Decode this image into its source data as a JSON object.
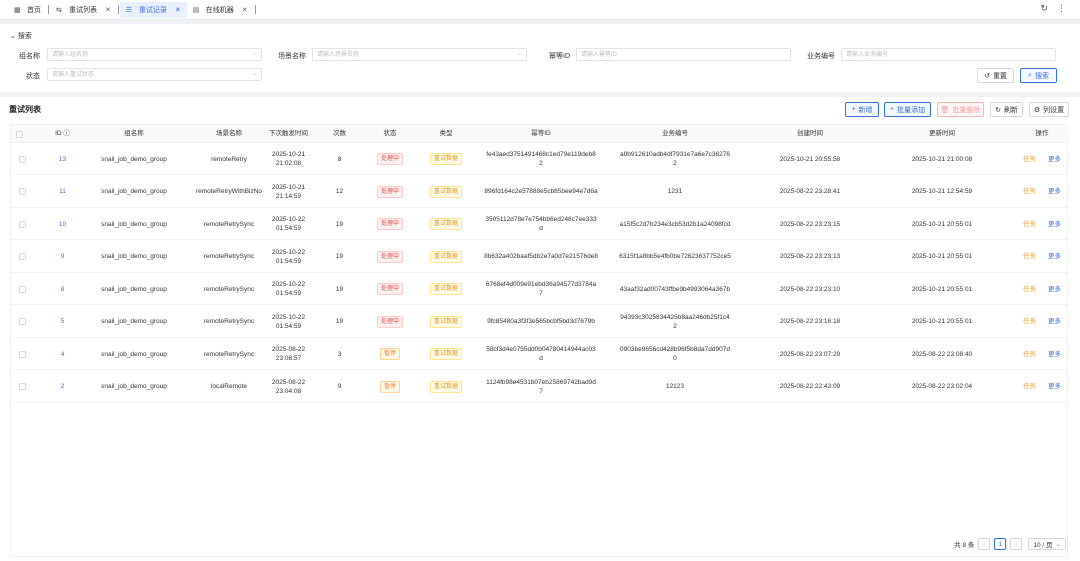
{
  "tabs": [
    {
      "icon": "grid-icon",
      "label": "首页"
    },
    {
      "icon": "flow-icon",
      "label": "重试列表"
    },
    {
      "icon": "list-icon",
      "label": "重试记录"
    },
    {
      "icon": "server-icon",
      "label": "在线机器"
    }
  ],
  "search": {
    "title": "搜索",
    "group_label": "组名称",
    "group_placeholder": "请输入组名称",
    "scene_label": "场景名称",
    "scene_placeholder": "请输入场景名称",
    "idem_label": "幂等ID",
    "idem_placeholder": "请输入幂等ID",
    "biz_label": "业务编号",
    "biz_placeholder": "请输入业务编号",
    "status_label": "状态",
    "status_placeholder": "请输入重试状态",
    "reset": "重置",
    "search": "搜索"
  },
  "table": {
    "title": "重试列表",
    "btn_add": "新增",
    "btn_batch_add": "批量添加",
    "btn_batch_delete": "批量删除",
    "btn_refresh": "刷新",
    "btn_columns": "列设置",
    "headers": [
      "ID",
      "组名称",
      "场景名称",
      "下次触发时间",
      "次数",
      "状态",
      "类型",
      "幂等ID",
      "业务编号",
      "创建时间",
      "更新时间",
      "操作"
    ],
    "op_task": "任务",
    "op_more": "更多",
    "rows": [
      {
        "id": "13",
        "group": "snail_job_demo_group",
        "scene": "remoteRetry",
        "next1": "2025-10-21",
        "next2": "21:02:08",
        "count": "8",
        "status": "处理中",
        "status_color": "red",
        "type": "重试数据",
        "idem": "fe43aed3751491468c1ed79e119deb8\n2",
        "biz": "a0b912610adb4df7931e7a6e7c36276\n2",
        "created": "2025-10-21 20:55:58",
        "updated": "2025-10-21 21:00:08"
      },
      {
        "id": "11",
        "group": "snail_job_demo_group",
        "scene": "remoteRetryWithBizNo",
        "next1": "2025-10-21",
        "next2": "21:14:59",
        "count": "12",
        "status": "处理中",
        "status_color": "red",
        "type": "重试数据",
        "idem": "896fd164c2e57888e5cb85bee94e7d6a",
        "biz": "1231",
        "created": "2025-08-22 23:28:41",
        "updated": "2025-10-21 12:54:59"
      },
      {
        "id": "10",
        "group": "snail_job_demo_group",
        "scene": "remoteRetrySync",
        "next1": "2025-10-22",
        "next2": "01:54:59",
        "count": "19",
        "status": "处理中",
        "status_color": "red",
        "type": "重试数据",
        "idem": "3505112d78e7e754bb6ed248c7ee333\nd",
        "biz": "a15f5c2d7b234e3cb53d2b1a24098fcd",
        "created": "2025-08-22 23:23:15",
        "updated": "2025-10-21 20:55:01"
      },
      {
        "id": "9",
        "group": "snail_job_demo_group",
        "scene": "remoteRetrySync",
        "next1": "2025-10-22",
        "next2": "01:54:59",
        "count": "19",
        "status": "处理中",
        "status_color": "red",
        "type": "重试数据",
        "idem": "8b632a402baaf5db2e7a0d7e21576de8",
        "biz": "6315f1a8bb5e4fb0be72623637752ce5",
        "created": "2025-08-22 23:23:13",
        "updated": "2025-10-21 20:55:01"
      },
      {
        "id": "8",
        "group": "snail_job_demo_group",
        "scene": "remoteRetrySync",
        "next1": "2025-10-22",
        "next2": "01:54:59",
        "count": "19",
        "status": "处理中",
        "status_color": "red",
        "type": "重试数据",
        "idem": "6768ef4d009e91ebd36a94577d3784a\n7",
        "biz": "43aaf32ad00743ffbe9b4993064a367b",
        "created": "2025-08-22 23:23:10",
        "updated": "2025-10-21 20:55:01"
      },
      {
        "id": "5",
        "group": "snail_job_demo_group",
        "scene": "remoteRetrySync",
        "next1": "2025-10-22",
        "next2": "01:54:59",
        "count": "19",
        "status": "处理中",
        "status_color": "red",
        "type": "重试数据",
        "idem": "9fc85480a3f3f3e565bcbf5bd3d7679b",
        "biz": "94393c3025834425b8aa246db25f1c4\n2",
        "created": "2025-08-22 23:16:18",
        "updated": "2025-10-21 20:55:01"
      },
      {
        "id": "4",
        "group": "snail_job_demo_group",
        "scene": "remoteRetrySync",
        "next1": "2025-08-22",
        "next2": "23:08:57",
        "count": "3",
        "status": "暂停",
        "status_color": "orange",
        "type": "重试数据",
        "idem": "58cf3d4e0755dd0b04780414944ac03\nd",
        "biz": "0903be9656cd428b96f5b8da7dd907d\n0",
        "created": "2025-08-22 23:07:29",
        "updated": "2025-08-22 23:08:40"
      },
      {
        "id": "2",
        "group": "snail_job_demo_group",
        "scene": "localRemote",
        "next1": "2025-08-22",
        "next2": "23:04:08",
        "count": "9",
        "status": "暂停",
        "status_color": "orange",
        "type": "重试数据",
        "idem": "1124fb98e4531b07eb25869742bad9d\n7",
        "biz": "12123",
        "created": "2025-08-22 22:43:09",
        "updated": "2025-08-22 23:02:04"
      }
    ]
  },
  "pager": {
    "total": "共 8 条",
    "prev": "‹",
    "current": "1",
    "next": "›",
    "size": "10 / 页"
  }
}
